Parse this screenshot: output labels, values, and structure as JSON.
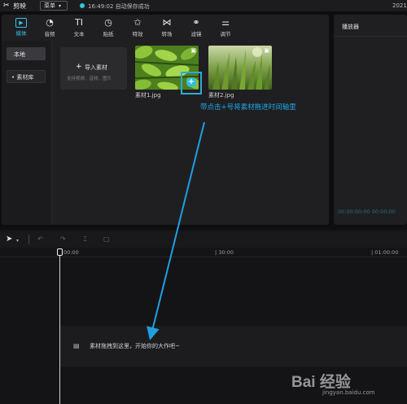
{
  "titlebar": {
    "app_name": "剪映",
    "menu_label": "菜单",
    "save_status": "16:49:02 自动保存成功",
    "year": "2021"
  },
  "toolbar": {
    "items": [
      {
        "label": "媒体",
        "icon": "media-icon",
        "glyph": "▶",
        "active": true
      },
      {
        "label": "音频",
        "icon": "audio-icon",
        "glyph": "◔"
      },
      {
        "label": "文本",
        "icon": "text-icon",
        "glyph": "TI"
      },
      {
        "label": "贴纸",
        "icon": "sticker-icon",
        "glyph": "◷"
      },
      {
        "label": "特效",
        "icon": "effects-icon",
        "glyph": "✩"
      },
      {
        "label": "转场",
        "icon": "transition-icon",
        "glyph": "⋈"
      },
      {
        "label": "滤镜",
        "icon": "filter-icon",
        "glyph": "⚭"
      },
      {
        "label": "调节",
        "icon": "adjust-icon",
        "glyph": "⚌"
      }
    ]
  },
  "sidebar": {
    "local": "本地",
    "library": "• 素材库"
  },
  "import_card": {
    "label": "导入素材",
    "hint": "支持视频、音频、图片"
  },
  "media_items": [
    {
      "name": "素材1.jpg"
    },
    {
      "name": "素材2.jpg"
    }
  ],
  "annotation": "带点击+号将素材拖进时间轴里",
  "player": {
    "title": "播放器",
    "time": "00:00:00:00  00:00:00"
  },
  "timeline": {
    "ticks": [
      "00:00",
      "| 30:00",
      "| 01:00:00"
    ],
    "hint": "素材拖拽到这里，开始你的大作吧~"
  },
  "watermark": {
    "logo": "Bai 经验",
    "url": "jingyan.baidu.com"
  }
}
